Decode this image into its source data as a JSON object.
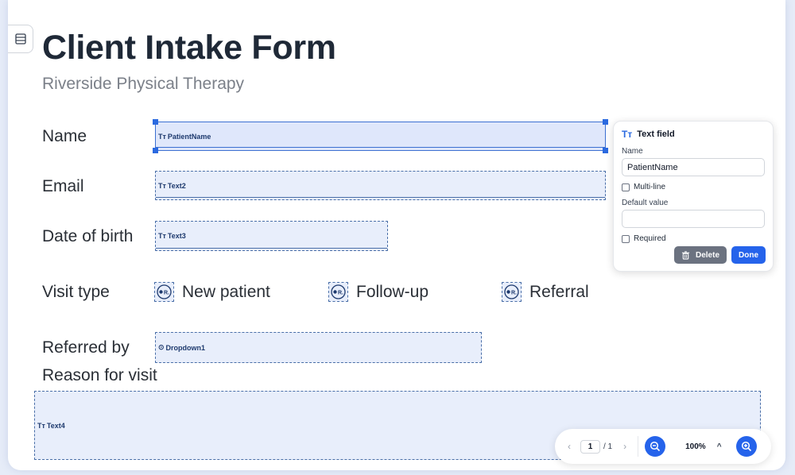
{
  "document": {
    "title": "Client Intake Form",
    "subtitle": "Riverside Physical Therapy"
  },
  "form": {
    "labels": {
      "name": "Name",
      "email": "Email",
      "dob": "Date of birth",
      "visit_type": "Visit type",
      "referred_by": "Referred by",
      "reason": "Reason for visit"
    },
    "fields": {
      "name": {
        "icon": "Tт",
        "id": "PatientName"
      },
      "email": {
        "icon": "Tт",
        "id": "Text2"
      },
      "dob": {
        "icon": "Tт",
        "id": "Text3"
      },
      "referred": {
        "icon": "⊙",
        "id": "Dropdown1"
      },
      "reason": {
        "icon": "Tт",
        "id": "Text4"
      }
    },
    "radio_options": [
      {
        "label": "New patient",
        "tag": "R."
      },
      {
        "label": "Follow-up",
        "tag": "R."
      },
      {
        "label": "Referral",
        "tag": "R."
      }
    ]
  },
  "properties_panel": {
    "icon": "Tт",
    "title": "Text field",
    "name_label": "Name",
    "name_value": "PatientName",
    "multiline_label": "Multi-line",
    "default_label": "Default value",
    "default_value": "",
    "required_label": "Required",
    "delete_label": "Delete",
    "done_label": "Done"
  },
  "pager": {
    "prev": "‹",
    "current_page": "1",
    "total": "/ 1",
    "next": "›",
    "zoom": "100%",
    "zoom_menu": "^"
  },
  "colors": {
    "accent": "#2563eb",
    "field_fill": "#e8eefb",
    "field_border": "#4a6fa8"
  }
}
